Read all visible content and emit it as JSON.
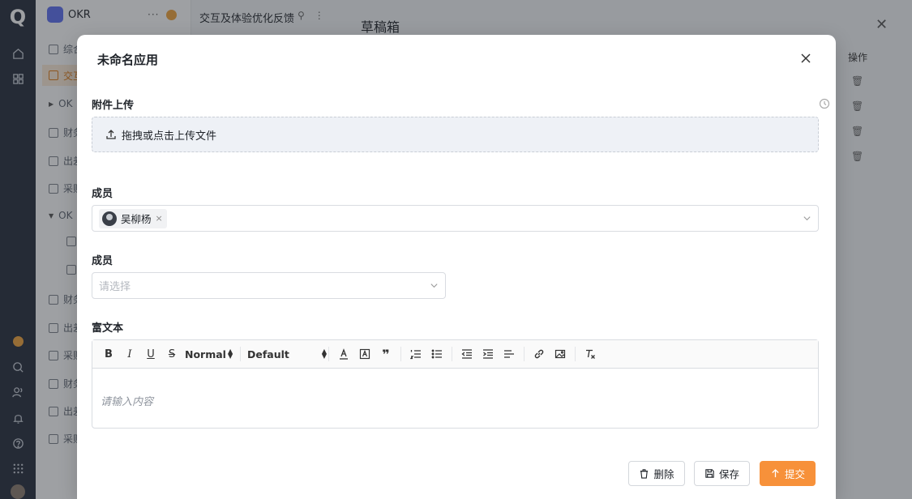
{
  "background": {
    "app_name": "OKR",
    "page_title": "交互及体验优化反馈",
    "drawer_title": "草稿箱",
    "ops_header": "操作",
    "sidebar_items": [
      {
        "label": "综合"
      },
      {
        "label": "交互"
      },
      {
        "label": "OK"
      },
      {
        "label": "财务"
      },
      {
        "label": "出差"
      },
      {
        "label": "采购"
      },
      {
        "label": "OK"
      },
      {
        "label": ""
      },
      {
        "label": ""
      },
      {
        "label": "财务"
      },
      {
        "label": "出差"
      },
      {
        "label": "采购"
      },
      {
        "label": "财务"
      },
      {
        "label": "出差"
      },
      {
        "label": "采购"
      }
    ]
  },
  "modal": {
    "title": "未命名应用",
    "upload": {
      "label": "附件上传",
      "prompt": "拖拽或点击上传文件"
    },
    "members_1": {
      "label": "成员",
      "selected": [
        {
          "name": "吴柳杨"
        }
      ]
    },
    "members_2": {
      "label": "成员",
      "placeholder": "请选择"
    },
    "rich_text": {
      "label": "富文本",
      "format_select": "Normal",
      "font_select": "Default",
      "placeholder": "请输入内容"
    },
    "buttons": {
      "delete": "删除",
      "save": "保存",
      "submit": "提交"
    }
  },
  "colors": {
    "accent": "#f7913a",
    "rail_bg": "#232a3a",
    "active_bg": "#fdebd7"
  }
}
